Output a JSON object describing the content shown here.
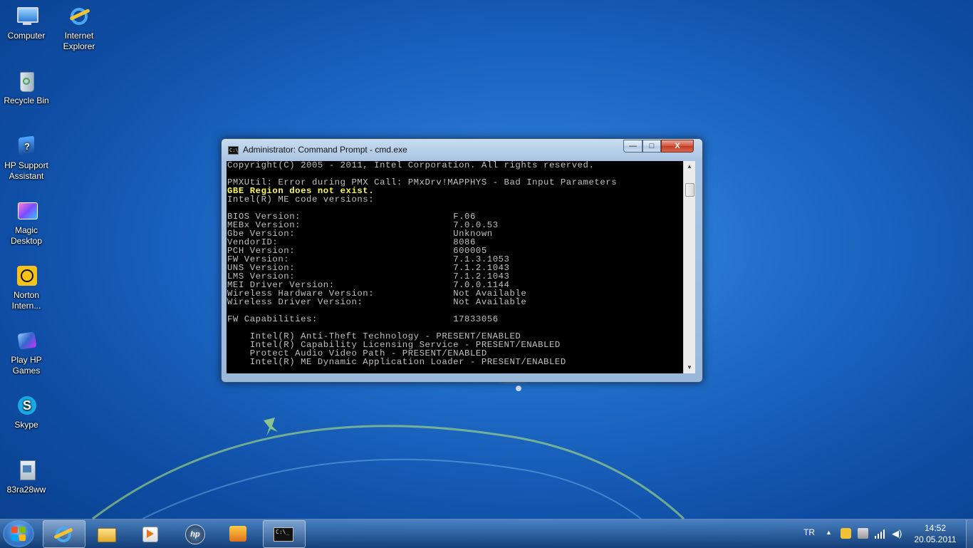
{
  "desktop": {
    "icons": [
      {
        "label": "Computer"
      },
      {
        "label": "Internet Explorer"
      },
      {
        "label": "Recycle Bin"
      },
      {
        "label": "HP Support Assistant"
      },
      {
        "label": "Magic Desktop"
      },
      {
        "label": "Norton Intern..."
      },
      {
        "label": "Play HP Games"
      },
      {
        "label": "Skype"
      },
      {
        "label": "83ra28ww"
      }
    ]
  },
  "window": {
    "title": "Administrator: Command Prompt - cmd.exe",
    "buttons": {
      "minimize": "—",
      "maximize": "□",
      "close": "X"
    },
    "console": {
      "line_copyright": "Copyright(C) 2005 - 2011, Intel Corporation. All rights reserved.",
      "line_error": "PMXUtil: Error during PMX Call: PMxDrv!MAPPHYS - Bad Input Parameters",
      "line_gbe": "GBE Region does not exist.",
      "line_me_versions": "Intel(R) ME code versions:",
      "versions": [
        {
          "key": "BIOS Version:",
          "value": "F.06"
        },
        {
          "key": "MEBx Version:",
          "value": "7.0.0.53"
        },
        {
          "key": "Gbe Version:",
          "value": "Unknown"
        },
        {
          "key": "VendorID:",
          "value": "8086"
        },
        {
          "key": "PCH Version:",
          "value": "600005"
        },
        {
          "key": "FW Version:",
          "value": "7.1.3.1053"
        },
        {
          "key": "UNS Version:",
          "value": "7.1.2.1043"
        },
        {
          "key": "LMS Version:",
          "value": "7.1.2.1043"
        },
        {
          "key": "MEI Driver Version:",
          "value": "7.0.0.1144"
        },
        {
          "key": "Wireless Hardware Version:",
          "value": "Not Available"
        },
        {
          "key": "Wireless Driver Version:",
          "value": "Not Available"
        }
      ],
      "fw_capabilities": {
        "key": "FW Capabilities:",
        "value": "17833056"
      },
      "capabilities": [
        "Intel(R) Anti-Theft Technology - PRESENT/ENABLED",
        "Intel(R) Capability Licensing Service - PRESENT/ENABLED",
        "Protect Audio Video Path - PRESENT/ENABLED",
        "Intel(R) ME Dynamic Application Loader - PRESENT/ENABLED"
      ]
    }
  },
  "taskbar": {
    "pinned": [
      {
        "icon": "internet-explorer-icon"
      },
      {
        "icon": "windows-explorer-icon"
      },
      {
        "icon": "media-player-icon"
      },
      {
        "icon": "hp-icon"
      },
      {
        "icon": "norton-icon"
      },
      {
        "icon": "command-prompt-icon"
      }
    ],
    "language": "TR",
    "clock": {
      "time": "14:52",
      "date": "20.05.2011"
    }
  },
  "colors": {
    "console_bg": "#000000",
    "console_text": "#c0c0c0",
    "console_highlight": "#ffff55"
  }
}
